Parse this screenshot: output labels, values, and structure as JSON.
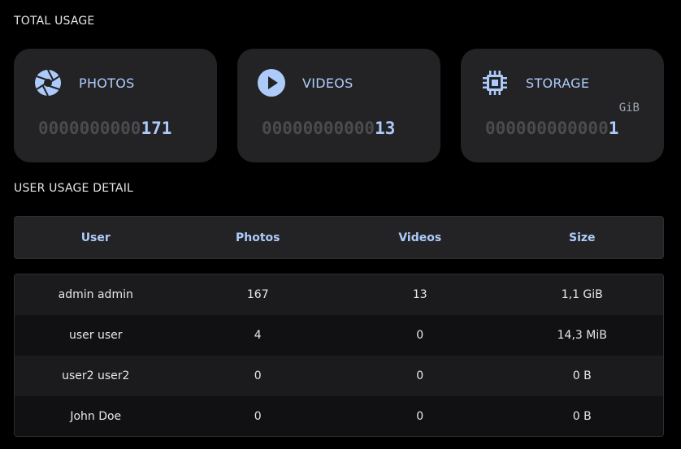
{
  "total_usage": {
    "title": "TOTAL USAGE",
    "cards": [
      {
        "label": "PHOTOS",
        "icon": "aperture-icon",
        "padding": "0000000000",
        "value": "171",
        "unit": ""
      },
      {
        "label": "VIDEOS",
        "icon": "play-circle-icon",
        "padding": "00000000000",
        "value": "13",
        "unit": ""
      },
      {
        "label": "STORAGE",
        "icon": "chip-icon",
        "padding": "000000000000",
        "value": "1",
        "unit": "GiB"
      }
    ]
  },
  "user_usage": {
    "title": "USER USAGE DETAIL",
    "columns": [
      "User",
      "Photos",
      "Videos",
      "Size"
    ],
    "rows": [
      {
        "user": "admin admin",
        "photos": "167",
        "videos": "13",
        "size": "1,1 GiB"
      },
      {
        "user": "user user",
        "photos": "4",
        "videos": "0",
        "size": "14,3 MiB"
      },
      {
        "user": "user2 user2",
        "photos": "0",
        "videos": "0",
        "size": "0 B"
      },
      {
        "user": "John Doe",
        "photos": "0",
        "videos": "0",
        "size": "0 B"
      }
    ]
  },
  "colors": {
    "accent": "#adcbfa",
    "card_bg": "#232325",
    "page_bg": "#000000"
  }
}
